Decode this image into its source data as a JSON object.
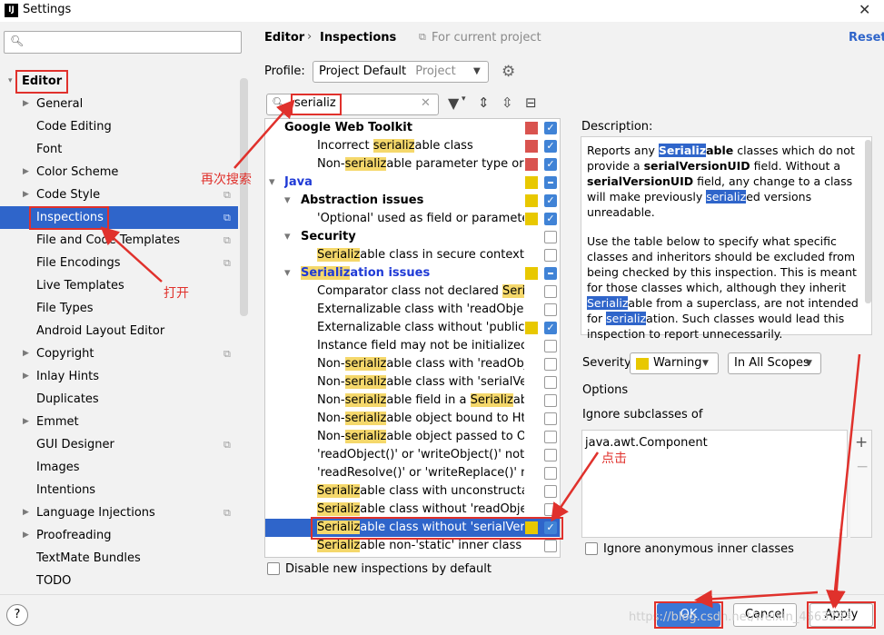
{
  "window": {
    "title": "Settings",
    "app_icon": "intellij-icon"
  },
  "sidebar": {
    "search_placeholder": "",
    "items": [
      {
        "label": "Editor",
        "level": 0,
        "expanded": true,
        "section": true
      },
      {
        "label": "General",
        "arrow": true
      },
      {
        "label": "Code Editing"
      },
      {
        "label": "Font"
      },
      {
        "label": "Color Scheme",
        "arrow": true
      },
      {
        "label": "Code Style",
        "arrow": true,
        "project": true
      },
      {
        "label": "Inspections",
        "selected": true,
        "project": true
      },
      {
        "label": "File and Code Templates",
        "project": true
      },
      {
        "label": "File Encodings",
        "project": true
      },
      {
        "label": "Live Templates"
      },
      {
        "label": "File Types"
      },
      {
        "label": "Android Layout Editor"
      },
      {
        "label": "Copyright",
        "arrow": true,
        "project": true
      },
      {
        "label": "Inlay Hints",
        "arrow": true
      },
      {
        "label": "Duplicates"
      },
      {
        "label": "Emmet",
        "arrow": true
      },
      {
        "label": "GUI Designer",
        "project": true
      },
      {
        "label": "Images"
      },
      {
        "label": "Intentions"
      },
      {
        "label": "Language Injections",
        "arrow": true,
        "project": true
      },
      {
        "label": "Proofreading",
        "arrow": true
      },
      {
        "label": "TextMate Bundles"
      },
      {
        "label": "TODO"
      }
    ]
  },
  "header": {
    "breadcrumb_editor": "Editor",
    "breadcrumb_sep": "›",
    "breadcrumb_inspections": "Inspections",
    "for_project": "For current project",
    "reset": "Reset"
  },
  "profile": {
    "label": "Profile:",
    "value": "Project Default",
    "scope": "Project"
  },
  "filter": {
    "value": "serializ"
  },
  "inspections": [
    {
      "segs": [
        [
          "Google Web Toolkit",
          ""
        ]
      ],
      "indent": 1,
      "bold": true,
      "sq": "#d9534f",
      "cb": "on"
    },
    {
      "segs": [
        [
          "Incorrect ",
          ""
        ],
        [
          "serializ",
          "m"
        ],
        [
          "able class",
          ""
        ]
      ],
      "indent": 2,
      "sq": "#d9534f",
      "cb": "on"
    },
    {
      "segs": [
        [
          "Non-",
          ""
        ],
        [
          "serializ",
          "m"
        ],
        [
          "able parameter type or return",
          ""
        ]
      ],
      "indent": 2,
      "sq": "#d9534f",
      "cb": "on"
    },
    {
      "segs": [
        [
          "Java",
          ""
        ]
      ],
      "indent": 0,
      "bold": true,
      "blue": true,
      "arrow": "▾",
      "sq": "#e8c800",
      "cb": "mix"
    },
    {
      "segs": [
        [
          "Abstraction issues",
          ""
        ]
      ],
      "indent": 1,
      "bold": true,
      "arrow": "▾",
      "sq": "#e8c800",
      "cb": "on"
    },
    {
      "segs": [
        [
          "'Optional' used as field or parameter t",
          ""
        ]
      ],
      "indent": 2,
      "sq": "#e8c800",
      "cb": "on"
    },
    {
      "segs": [
        [
          "Security",
          ""
        ]
      ],
      "indent": 1,
      "bold": true,
      "arrow": "▾",
      "cb": "off"
    },
    {
      "segs": [
        [
          "Serializ",
          "m"
        ],
        [
          "able class in secure context",
          ""
        ]
      ],
      "indent": 2,
      "cb": "off"
    },
    {
      "segs": [
        [
          "Serializ",
          "m"
        ],
        [
          "ation issues",
          ""
        ]
      ],
      "indent": 1,
      "bold": true,
      "blue": true,
      "arrow": "▾",
      "sq": "#e8c800",
      "cb": "mix"
    },
    {
      "segs": [
        [
          "Comparator class not declared ",
          ""
        ],
        [
          "Serializ",
          "m"
        ]
      ],
      "indent": 2,
      "cb": "off"
    },
    {
      "segs": [
        [
          "Externalizable class with 'readObject()'",
          ""
        ]
      ],
      "indent": 2,
      "cb": "off"
    },
    {
      "segs": [
        [
          "Externalizable class without 'public' no-",
          ""
        ]
      ],
      "indent": 2,
      "sq": "#e8c800",
      "cb": "on"
    },
    {
      "segs": [
        [
          "Instance field may not be initialized by",
          ""
        ]
      ],
      "indent": 2,
      "cb": "off"
    },
    {
      "segs": [
        [
          "Non-",
          ""
        ],
        [
          "serializ",
          "m"
        ],
        [
          "able class with 'readObject",
          ""
        ]
      ],
      "indent": 2,
      "cb": "off"
    },
    {
      "segs": [
        [
          "Non-",
          ""
        ],
        [
          "serializ",
          "m"
        ],
        [
          "able class with 'serialVersionUID'",
          ""
        ]
      ],
      "indent": 2,
      "cb": "off"
    },
    {
      "segs": [
        [
          "Non-",
          ""
        ],
        [
          "serializ",
          "m"
        ],
        [
          "able field in a ",
          ""
        ],
        [
          "Serializ",
          "m"
        ],
        [
          "able c",
          ""
        ]
      ],
      "indent": 2,
      "cb": "off"
    },
    {
      "segs": [
        [
          "Non-",
          ""
        ],
        [
          "serializ",
          "m"
        ],
        [
          "able object bound to HttpS",
          ""
        ]
      ],
      "indent": 2,
      "cb": "off"
    },
    {
      "segs": [
        [
          "Non-",
          ""
        ],
        [
          "serializ",
          "m"
        ],
        [
          "able object passed to Obje",
          ""
        ]
      ],
      "indent": 2,
      "cb": "off"
    },
    {
      "segs": [
        [
          "'readObject()' or 'writeObject()' not dec",
          ""
        ]
      ],
      "indent": 2,
      "cb": "off"
    },
    {
      "segs": [
        [
          "'readResolve()' or 'writeReplace()' not c",
          ""
        ]
      ],
      "indent": 2,
      "cb": "off"
    },
    {
      "segs": [
        [
          "Serializ",
          "m"
        ],
        [
          "able class with unconstructable",
          ""
        ]
      ],
      "indent": 2,
      "cb": "off"
    },
    {
      "segs": [
        [
          "Serializ",
          "m"
        ],
        [
          "able class without 'readObject()",
          ""
        ]
      ],
      "indent": 2,
      "cb": "off"
    },
    {
      "segs": [
        [
          "Serializ",
          "m"
        ],
        [
          "able class without 'serialVersion",
          ""
        ]
      ],
      "indent": 2,
      "sq": "#e8c800",
      "cb": "on",
      "selected": true
    },
    {
      "segs": [
        [
          "Serializ",
          "m"
        ],
        [
          "able non-'static' inner class with",
          ""
        ]
      ],
      "indent": 2,
      "cb": "off"
    }
  ],
  "disable_new": "Disable new inspections by default",
  "description": {
    "label": "Description:",
    "p1": [
      [
        "Reports any ",
        ""
      ],
      [
        "Serializ",
        "h"
      ],
      [
        "able",
        "b"
      ],
      [
        " classes which do not provide a ",
        ""
      ],
      [
        "serialVersionUID",
        "b"
      ],
      [
        " field. Without a ",
        ""
      ],
      [
        "serialVersionUID",
        "b"
      ],
      [
        " field, any change to a class will make previously ",
        ""
      ],
      [
        "serializ",
        "h"
      ],
      [
        "ed versions unreadable.",
        ""
      ]
    ],
    "p2": [
      [
        "Use the table below to specify what specific classes and inheritors should be excluded from being checked by this inspection. This is meant for those classes which, although they inherit ",
        ""
      ],
      [
        "Serializ",
        "h"
      ],
      [
        "able from a superclass, are not intended for ",
        ""
      ],
      [
        "serializ",
        "h"
      ],
      [
        "ation. Such classes would lead this inspection to report unnecessarily.",
        ""
      ]
    ]
  },
  "severity": {
    "label": "Severity:",
    "value": "Warning",
    "color": "#e8c800",
    "scope": "In All Scopes"
  },
  "options": {
    "label": "Options",
    "ignore_label": "Ignore subclasses of",
    "items": [
      "java.awt.Component"
    ],
    "add": "+",
    "remove": "−",
    "ignore_anon": "Ignore anonymous inner classes"
  },
  "footer": {
    "help": "?",
    "ok": "OK",
    "cancel": "Cancel",
    "apply": "Apply"
  },
  "annotations": {
    "search_again": "再次搜索",
    "open": "打开",
    "click": "点击"
  },
  "watermark": "https://blog.csdn.net/weixin_4663293"
}
